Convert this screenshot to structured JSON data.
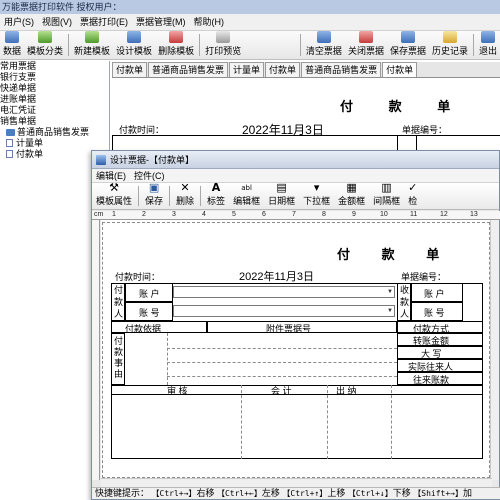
{
  "app": {
    "title": "万能票据打印软件  授权用户：",
    "menu": [
      "用户(S)",
      "视图(V)",
      "票据打印(E)",
      "票据管理(M)",
      "帮助(H)"
    ],
    "toolbar": [
      "数据",
      "模板分类",
      "新建模板",
      "设计模板",
      "删除模板",
      "打印预览",
      "清空票据",
      "关闭票据",
      "保存票据",
      "历史记录",
      "退出"
    ]
  },
  "tree": {
    "items": [
      "常用票据",
      "银行支票",
      "快递单据",
      "进账单据",
      "电汇凭证",
      "销售单据"
    ],
    "children": [
      "普通商品销售发票",
      "计量单",
      "付款单"
    ]
  },
  "main_tabs": [
    "付款单",
    "普通商品销售发票",
    "计量单",
    "付款单",
    "普通商品销售发票",
    "付款单"
  ],
  "background_doc": {
    "title": "付 款 单",
    "date_label": "付款时间：",
    "date_value": "2022年11月3日",
    "number_label": "单据编号："
  },
  "window": {
    "title": "设计票据-【付款单】",
    "menu": [
      "编辑(E)",
      "控件(C)"
    ],
    "toolbar": [
      {
        "label": "模板属性",
        "icon": "tool-icon",
        "glyph": "⚒"
      },
      {
        "label": "保存",
        "icon": "save-icon",
        "glyph": "▣"
      },
      {
        "label": "删除",
        "icon": "delete-icon",
        "glyph": "✕"
      },
      {
        "label": "标签",
        "icon": "label-icon",
        "glyph": "A"
      },
      {
        "label": "编辑框",
        "icon": "edit-box-icon",
        "glyph": "abl"
      },
      {
        "label": "日期框",
        "icon": "date-box-icon",
        "glyph": "▤"
      },
      {
        "label": "下拉框",
        "icon": "dropdown-box-icon",
        "glyph": "▾"
      },
      {
        "label": "金额框",
        "icon": "amount-box-icon",
        "glyph": "▦"
      },
      {
        "label": "间隔框",
        "icon": "spacer-box-icon",
        "glyph": "▥"
      },
      {
        "label": "检",
        "icon": "check-icon",
        "glyph": "✓"
      }
    ],
    "ruler_unit": "cm",
    "ruler_numbers": [
      "1",
      "2",
      "3",
      "4",
      "5",
      "6",
      "7",
      "8",
      "9",
      "10",
      "11",
      "12",
      "13"
    ],
    "status_prefix": "快捷键提示：",
    "status_keys": [
      {
        "key": "【Ctrl+→】",
        "action": "右移"
      },
      {
        "key": "【Ctrl+←】",
        "action": "左移"
      },
      {
        "key": "【Ctrl+↑】",
        "action": "上移"
      },
      {
        "key": "【Ctrl+↓】",
        "action": "下移"
      },
      {
        "key": "【Shift+→】",
        "action": "加"
      }
    ]
  },
  "form": {
    "title": "付 款 单",
    "date_label": "付款时间：",
    "date_value": "2022年11月3日",
    "number_label": "单据编号：",
    "payer_label": "付款人",
    "payee_label": "收款人",
    "account_holder": "账 户",
    "account_no": "账 号",
    "payment_basis": "付款依据",
    "attachment_no": "附件票据号",
    "payment_method": "付款方式",
    "transfer_amount": "转账金额",
    "capital": "大 写",
    "actual_contact": "实际往来人",
    "contra_account": "往来账款",
    "payment_reason": "付款事由",
    "audit": "审 核",
    "accounting": "会 计",
    "cashier": "出 纳"
  }
}
